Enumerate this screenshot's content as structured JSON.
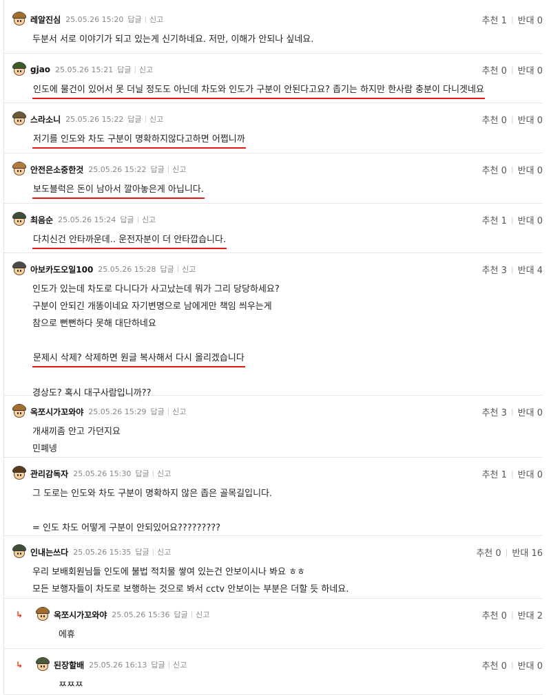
{
  "labels": {
    "reply": "답글",
    "report": "신고",
    "up": "추천",
    "down": "반대"
  },
  "reply_arrow": "↳",
  "comments": [
    {
      "nick": "레알진심",
      "date": "25.05.26 15:20",
      "up": 1,
      "down": 0,
      "hat": "#a06d2d",
      "lines": [
        {
          "text": "두분서 서로 이야기가 되고 있는게 신기하네요. 저만, 이해가 안되나 싶네요.",
          "underline": false
        }
      ]
    },
    {
      "nick": "gjao",
      "date": "25.05.26 15:21",
      "up": 0,
      "down": 0,
      "hat": "#3d5a2a",
      "lines": [
        {
          "text": "인도에 물건이 있어서 못 더닐 정도도 아닌데 차도와 인도가 구분이 안된다고요? 좁기는 하지만 한사람 충분이 다니겟네요",
          "underline": true
        }
      ]
    },
    {
      "nick": "스라소니",
      "date": "25.05.26 15:22",
      "up": 0,
      "down": 0,
      "hat": "#6b5a3a",
      "lines": [
        {
          "text": "저기를 인도와 차도 구분이 명확하지않다고하면 어쩝니까",
          "underline": true
        }
      ]
    },
    {
      "nick": "안전은소중한것",
      "date": "25.05.26 15:22",
      "up": 0,
      "down": 0,
      "hat": "#b07a3a",
      "lines": [
        {
          "text": "보도블럭은 돈이 남아서 깔아놓은게 아닙니다.",
          "underline": true
        }
      ]
    },
    {
      "nick": "최음순",
      "date": "25.05.26 15:24",
      "up": 1,
      "down": 0,
      "hat": "#3f4d38",
      "lines": [
        {
          "text": "다치신건 안타까운데.. 운전자분이 더 안타깝습니다.",
          "underline": true
        }
      ]
    },
    {
      "nick": "아보카도오일100",
      "date": "25.05.26 15:28",
      "up": 3,
      "down": 4,
      "hat": "#4a4a4a",
      "lines": [
        {
          "text": "인도가 있는데 차도로 다니다가 사고났는데 뭐가 그리 당당하세요?",
          "underline": false
        },
        {
          "text": "구분이 안되긴 개똥이네요 자기변명으로 남에게만 책임 씌우는게",
          "underline": false
        },
        {
          "text": "참으로 뻔뻔하다 못해 대단하네요",
          "underline": false
        },
        {
          "text": "",
          "underline": false
        },
        {
          "text": "문제시 삭제? 삭제하면 원글 복사해서 다시 올리겠습니다",
          "underline": true
        },
        {
          "text": "",
          "underline": false
        },
        {
          "text": "경상도? 혹시 대구사람입니까??",
          "underline": false
        }
      ]
    },
    {
      "nick": "옥쪼시가꼬와야",
      "date": "25.05.26 15:29",
      "up": 3,
      "down": 0,
      "hat": "#a06d2d",
      "lines": [
        {
          "text": "개새끼좀 안고 가던지요",
          "underline": false
        },
        {
          "text": "민폐넹",
          "underline": false
        }
      ]
    },
    {
      "nick": "관리감독자",
      "date": "25.05.26 15:30",
      "up": 1,
      "down": 0,
      "hat": "#5a3d1e",
      "lines": [
        {
          "text": "그 도로는 인도와 차도 구분이 명확하지 않은 좁은 골목길입니다.",
          "underline": false
        },
        {
          "text": "",
          "underline": false
        },
        {
          "text": "= 인도 차도 어떻게 구분이 안되있어요?????????",
          "underline": false
        }
      ]
    },
    {
      "nick": "인내는쓰다",
      "date": "25.05.26 15:35",
      "up": 0,
      "down": 16,
      "hat": "#3f4d38",
      "lines": [
        {
          "text": "우리 보배회원님들 인도에 불법 적치물 쌓여 있는건 안보이시나 봐요 ㅎㅎ",
          "underline": false
        },
        {
          "text": "모든 보행자들이 차도로 보행하는 것으로 봐서 cctv 안보이는 부분은 더할 듯 하네요.",
          "underline": false
        }
      ]
    },
    {
      "nick": "옥쪼시가꼬와야",
      "date": "25.05.26 15:36",
      "up": 0,
      "down": 2,
      "hat": "#a06d2d",
      "reply": true,
      "lines": [
        {
          "text": "에휴",
          "underline": false
        }
      ]
    },
    {
      "nick": "된장할배",
      "date": "25.05.26 16:13",
      "up": 0,
      "down": 0,
      "hat": "#4a5a3a",
      "reply": true,
      "lines": [
        {
          "text": "ㅉㅉㅉ",
          "underline": false
        }
      ]
    }
  ]
}
